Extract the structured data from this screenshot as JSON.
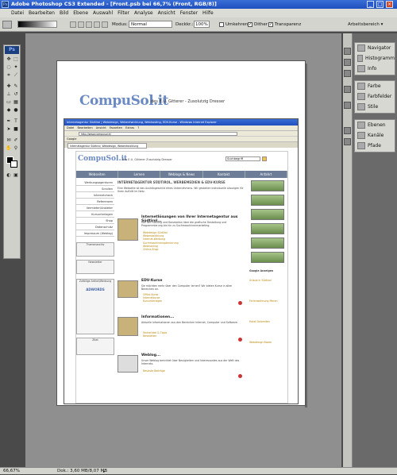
{
  "titlebar": {
    "title": "Adobe Photoshop CS3 Extended - [Front.psb bei 66,7% (Front, RGB/8)]",
    "app_icon": "Ps"
  },
  "menubar": {
    "items": [
      "Datei",
      "Bearbeiten",
      "Bild",
      "Ebene",
      "Auswahl",
      "Filter",
      "Analyse",
      "Ansicht",
      "Fenster",
      "Hilfe"
    ]
  },
  "options": {
    "modus_label": "Modus:",
    "modus_value": "Normal",
    "deckkraft_label": "Deckkr.:",
    "deckkraft_value": "100%",
    "umkehren": "Umkehren",
    "dither": "Dither",
    "transparenz": "Transparenz",
    "workspace": "Arbeitsbereich"
  },
  "toolbox": {
    "logo": "Ps"
  },
  "status": {
    "zoom": "66,67%",
    "doc_info": "Dok.: 3,60 MB/8,07 MB"
  },
  "panels": {
    "group1": [
      "Navigator",
      "Histogramm",
      "Info"
    ],
    "group2": [
      "Farbe",
      "Farbfelder",
      "Stile"
    ],
    "group3": [
      "Ebenen",
      "Kanäle",
      "Pfade"
    ]
  },
  "document": {
    "logo": "CompuSol.it",
    "tagline": "des E.U. Gitterer - Zusolutzig Dresser",
    "browser": {
      "title": "Internetagentur Südtirol | Webdesign, Webentwicklung, Webhosting, EDV-Kurse - Windows Internet Explorer",
      "menu": "Datei Bearbeiten Ansicht Favoriten Extras ?",
      "url": "http://www.compusol.it/",
      "google": "Google",
      "tab": "Internetagentur Südtirol, Webdesign, Webentwicklung"
    },
    "page": {
      "logo": "CompuSol.it",
      "tagline": "des E.U. Gitterer Zusolutzig Dresser",
      "search_value": "Suchbegriff",
      "nav": [
        "Webseiten",
        "Lernen",
        "Weblogs & News",
        "Kontakt",
        "Anfahrt"
      ],
      "side_items": [
        "Werbungsagenturen",
        "Scrollen",
        "Internetcheck",
        "Referenzen",
        "Vermieter/Anbieter",
        "Kursunterlagen",
        "Shop",
        "Datenschutz",
        "Impressum (Weblog)"
      ],
      "side_box1": "Themenarchiv",
      "side_box2": "Newsletter",
      "side_box3": "Zufällige Artikel/Werbung",
      "side_ad": "ADWORDS",
      "side_box4": "Zitat",
      "main_heading": "INTERNETAGENTUR SÜDTIROL, WERBEMEDIEN & EDV-KURSE",
      "main_intro": "Eine Webseite ist das Aushängeschild eines Unternehmens. Wir gestalten individuelle Lösungen für Ihren Auftritt im Netz.",
      "sections": [
        {
          "heading": "Internetlösungen von Ihrer Internetagentur aus Südtirol...",
          "text": "von der Planung und Konzeption über die grafische Gestaltung und Programmierung bis hin zu Suchmaschinenmarketing.",
          "links": [
            "Webdesign Südtirol",
            "Webentwicklung",
            "Internet-Werbung",
            "Suchmaschinenoptimierung",
            "Webhosting",
            "Online-Shop"
          ]
        },
        {
          "heading": "EDV-Kurse",
          "text": "Sie möchten mehr über den Computer lernen? Wir bieten Kurse in allen Bereichen an.",
          "links": [
            "Office-Kurse",
            "Internetkurse",
            "Kursunterlagen"
          ]
        },
        {
          "heading": "Informationen...",
          "text": "Aktuelle Informationen aus den Bereichen Internet, Computer und Software.",
          "links": [
            "Fachartikel & Tipps",
            "Newsletter"
          ]
        },
        {
          "heading": "Weblog...",
          "text": "Unser Weblog berichtet über Neuigkeiten und Interessantes aus der Welt des Internets.",
          "links": [
            "Neueste Beiträge"
          ]
        }
      ],
      "right_label": "Google Anzeigen",
      "right_text": [
        "Urlaub in Südtirol",
        "Ferienwohnung Meran",
        "Hotel Dolomiten",
        "Webdesign Bozen"
      ]
    }
  }
}
